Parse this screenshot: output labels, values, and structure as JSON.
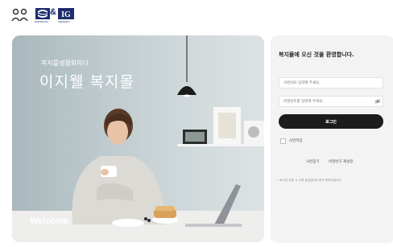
{
  "brand": {
    "s_logo_caption": "DAESEUNG",
    "ig_logo_caption": "IGEANING",
    "ig_logo_text": "IG",
    "ampersand": "&"
  },
  "hero": {
    "kicker": "복지를생활화하다",
    "title": "이지웰 복지몰",
    "welcome": "Welcome"
  },
  "login": {
    "title": "복지몰에 오신 것을 환영합니다.",
    "id_placeholder": "사번(ID) 입력해 주세요.",
    "password_placeholder": "비밀번호를 입력해 주세요.",
    "login_button": "로그인",
    "save_id_label": "사번저장",
    "find_id_link": "사번찾기",
    "reset_password_link": "비밀번호 재설정",
    "notice": "• 로그인 오류 시 고객 상담센터로 문의 부탁드립니다."
  },
  "colors": {
    "brand_navy": "#1d2d6e",
    "button_dark": "#1c1c1c",
    "panel_bg": "#f3f3f3",
    "hero_bg": "#c6d0d4"
  },
  "icons": {
    "people_logo": "two-people-outline-icon",
    "s_logo": "s-wave-logo-icon",
    "ig_logo": "ig-logo-icon",
    "eye": "eye-icon",
    "checkbox": "checkbox-icon"
  }
}
